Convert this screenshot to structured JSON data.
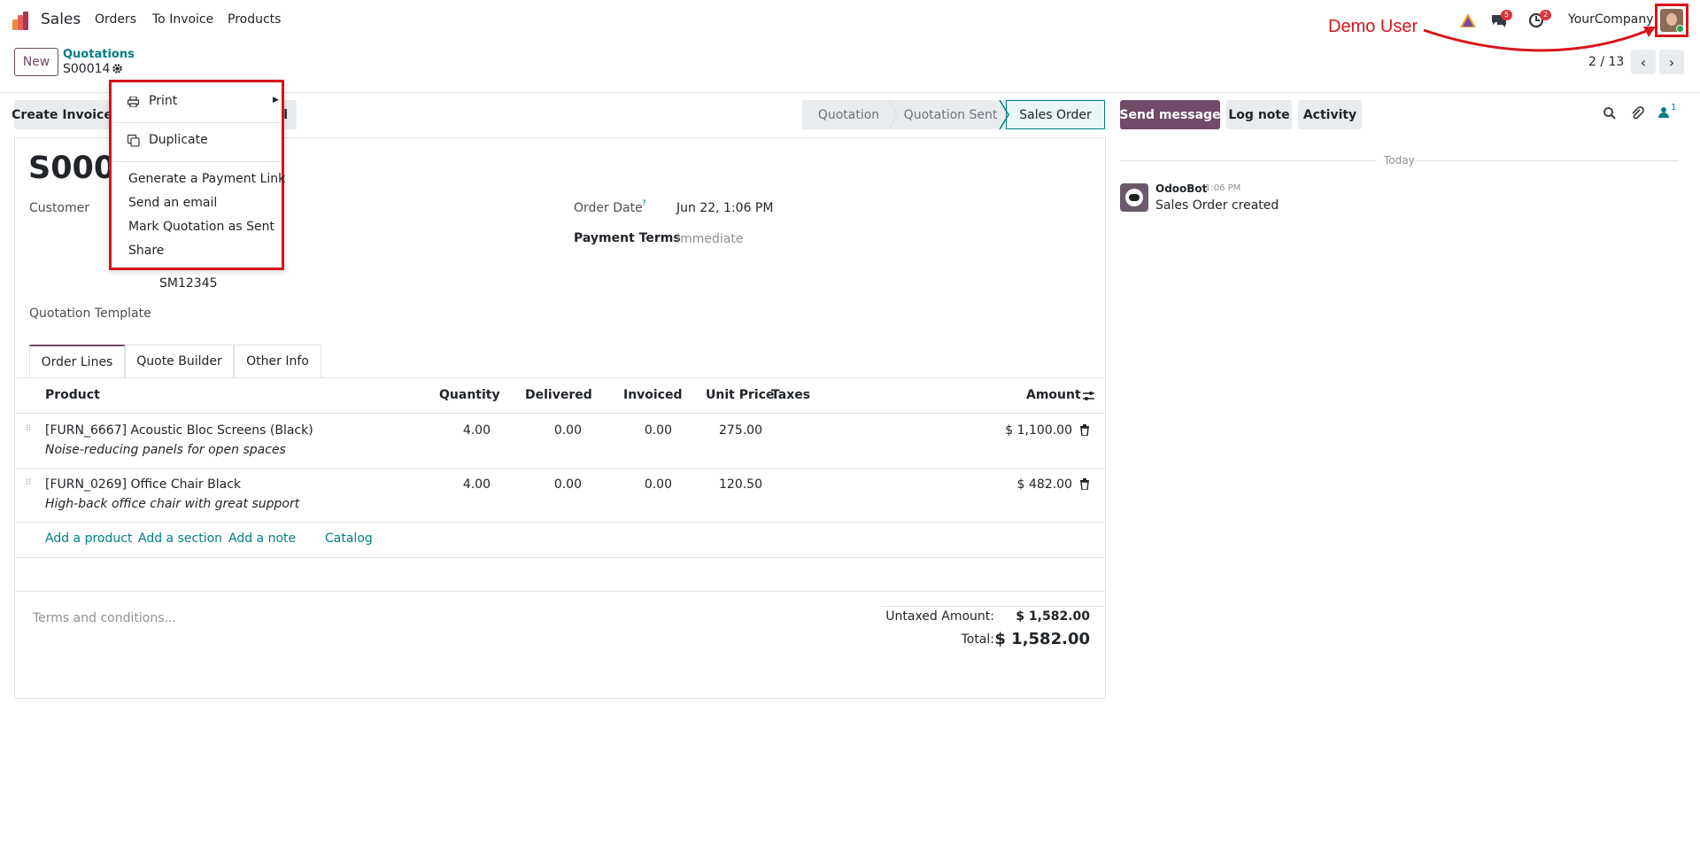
{
  "app": {
    "name": "Sales",
    "menu": [
      "Orders",
      "To Invoice",
      "Products"
    ]
  },
  "systray": {
    "messages_badge": "5",
    "activities_badge": "2",
    "company": "YourCompany",
    "user_annotation": "Demo User"
  },
  "control_panel": {
    "new_label": "New",
    "breadcrumb_parent": "Quotations",
    "breadcrumb_current": "S00014",
    "pager": "2 / 13"
  },
  "actions": {
    "create_invoice": "Create Invoice",
    "hidden_partial": "l"
  },
  "statusbar": {
    "stages": [
      "Quotation",
      "Quotation Sent",
      "Sales Order"
    ],
    "current": "Sales Order"
  },
  "form": {
    "name": "S0001",
    "customer_label": "Customer",
    "customer_ref": "SM12345",
    "order_date_label": "Order Date",
    "order_date_help": "?",
    "order_date": "Jun 22, 1:06 PM",
    "payment_terms_label": "Payment Terms",
    "payment_terms": "Immediate",
    "quotation_template_label": "Quotation Template"
  },
  "tabs": [
    "Order Lines",
    "Quote Builder",
    "Other Info"
  ],
  "order_lines": {
    "columns": [
      "Product",
      "Quantity",
      "Delivered",
      "Invoiced",
      "Unit Price",
      "Taxes",
      "Amount"
    ],
    "rows": [
      {
        "product": "[FURN_6667] Acoustic Bloc Screens (Black)",
        "description": "Noise-reducing panels for open spaces",
        "quantity": "4.00",
        "delivered": "0.00",
        "invoiced": "0.00",
        "unit_price": "275.00",
        "taxes": "",
        "amount": "$ 1,100.00"
      },
      {
        "product": "[FURN_0269] Office Chair Black",
        "description": "High-back office chair with great support",
        "quantity": "4.00",
        "delivered": "0.00",
        "invoiced": "0.00",
        "unit_price": "120.50",
        "taxes": "",
        "amount": "$ 482.00"
      }
    ],
    "add_links": [
      "Add a product",
      "Add a section",
      "Add a note",
      "Catalog"
    ]
  },
  "terms_placeholder": "Terms and conditions...",
  "totals": {
    "untaxed_label": "Untaxed Amount:",
    "untaxed_value": "$ 1,582.00",
    "total_label": "Total:",
    "total_value": "$ 1,582.00"
  },
  "chatter": {
    "send_message": "Send message",
    "log_note": "Log note",
    "activity": "Activity",
    "followers_count": "1",
    "day_separator": "Today",
    "message": {
      "author": "OdooBot",
      "time": "1:06 PM",
      "body": "Sales Order created"
    }
  },
  "action_menu": {
    "items": [
      "Print",
      "Duplicate",
      "Generate a Payment Link",
      "Send an email",
      "Mark Quotation as Sent",
      "Share"
    ]
  },
  "colors": {
    "brand": "#714b67",
    "link": "#017e84",
    "annotation": "#d8141b"
  }
}
